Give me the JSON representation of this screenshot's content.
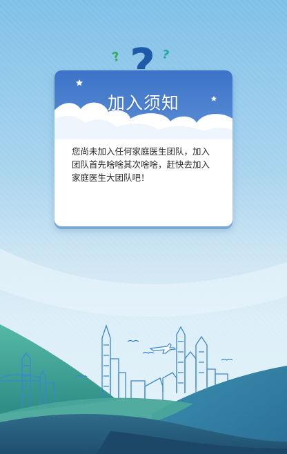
{
  "notice": {
    "title": "加入须知",
    "message": "您尚未加入任何家庭医生团队，加入团队首先啥啥其次啥啥，赶快去加入家庭医生大团队吧！"
  },
  "icons": {
    "header": "question-mark-icon",
    "decor": [
      "star-icon",
      "airplane-icon",
      "bird-icon"
    ]
  },
  "colors": {
    "header_blue": "#3d73c8",
    "question_mark": "#1f5aa8",
    "small_qmark_green": "#2fae5a",
    "small_qmark_teal": "#22a79b"
  }
}
